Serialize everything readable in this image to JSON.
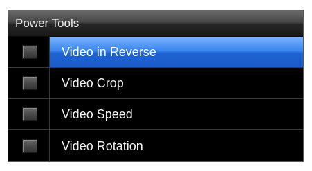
{
  "panel": {
    "title": "Power Tools",
    "selected_index": 0,
    "items": [
      {
        "label": "Video in Reverse",
        "checked": false
      },
      {
        "label": "Video Crop",
        "checked": false
      },
      {
        "label": "Video Speed",
        "checked": false
      },
      {
        "label": "Video Rotation",
        "checked": false
      }
    ]
  },
  "colors": {
    "background": "#000000",
    "selection": "#2a72e0",
    "text": "#f2f2f2"
  }
}
